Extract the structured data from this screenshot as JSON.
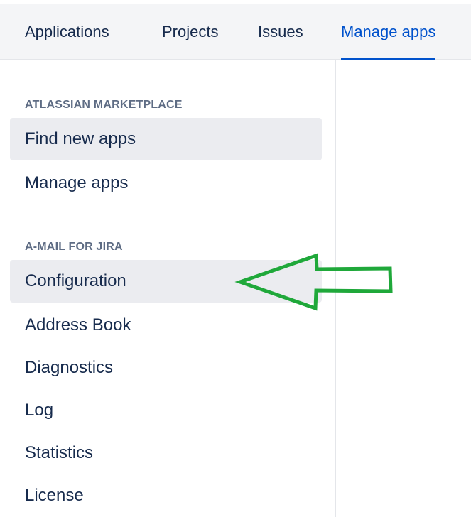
{
  "top_nav": {
    "tabs": [
      {
        "label": "Applications",
        "active": false
      },
      {
        "label": "Projects",
        "active": false
      },
      {
        "label": "Issues",
        "active": false
      },
      {
        "label": "Manage apps",
        "active": true
      }
    ]
  },
  "sidebar": {
    "sections": [
      {
        "header": "ATLASSIAN MARKETPLACE",
        "items": [
          {
            "label": "Find new apps",
            "selected": true
          },
          {
            "label": "Manage apps",
            "selected": false
          }
        ]
      },
      {
        "header": "A-MAIL FOR JIRA",
        "items": [
          {
            "label": "Configuration",
            "selected": true
          },
          {
            "label": "Address Book",
            "selected": false
          },
          {
            "label": "Diagnostics",
            "selected": false
          },
          {
            "label": "Log",
            "selected": false
          },
          {
            "label": "Statistics",
            "selected": false
          },
          {
            "label": "License",
            "selected": false
          }
        ]
      }
    ]
  },
  "annotation": {
    "icon": "arrow-left-icon",
    "color": "#1fa83a"
  },
  "colors": {
    "accent": "#0052cc",
    "text": "#172b4d",
    "muted": "#5e6c84",
    "selected_bg": "#ebecf0",
    "nav_bg": "#f4f5f7"
  }
}
